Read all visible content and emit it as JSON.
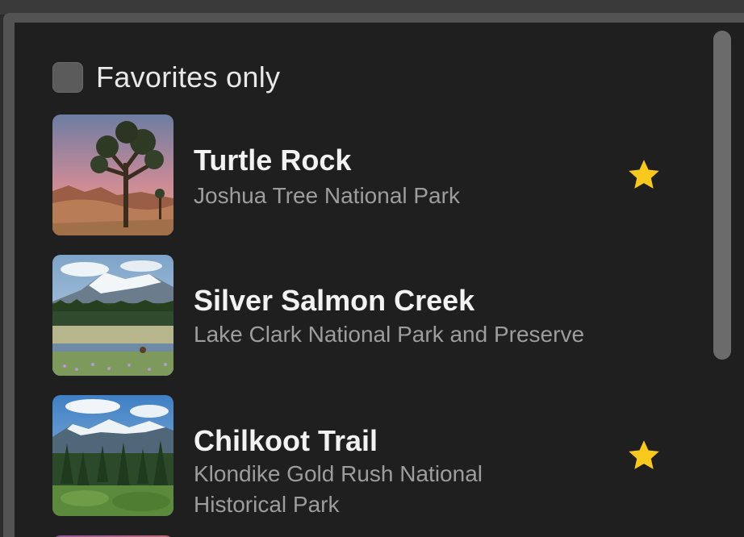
{
  "filter": {
    "favorites_label": "Favorites only",
    "favorites_checked": false
  },
  "landmarks": [
    {
      "name": "Turtle Rock",
      "park": "Joshua Tree National Park",
      "favorite": true,
      "image": "joshua-tree-photo"
    },
    {
      "name": "Silver Salmon Creek",
      "park": "Lake Clark National Park and Preserve",
      "favorite": false,
      "image": "mountain-meadow-photo"
    },
    {
      "name": "Chilkoot Trail",
      "park": "Klondike Gold Rush National Historical Park",
      "favorite": true,
      "image": "forest-mountains-photo"
    }
  ],
  "colors": {
    "star": "#f7c91c",
    "background": "#1f1f1f",
    "title": "#f2f2f2",
    "subtitle": "#9d9d9d"
  }
}
